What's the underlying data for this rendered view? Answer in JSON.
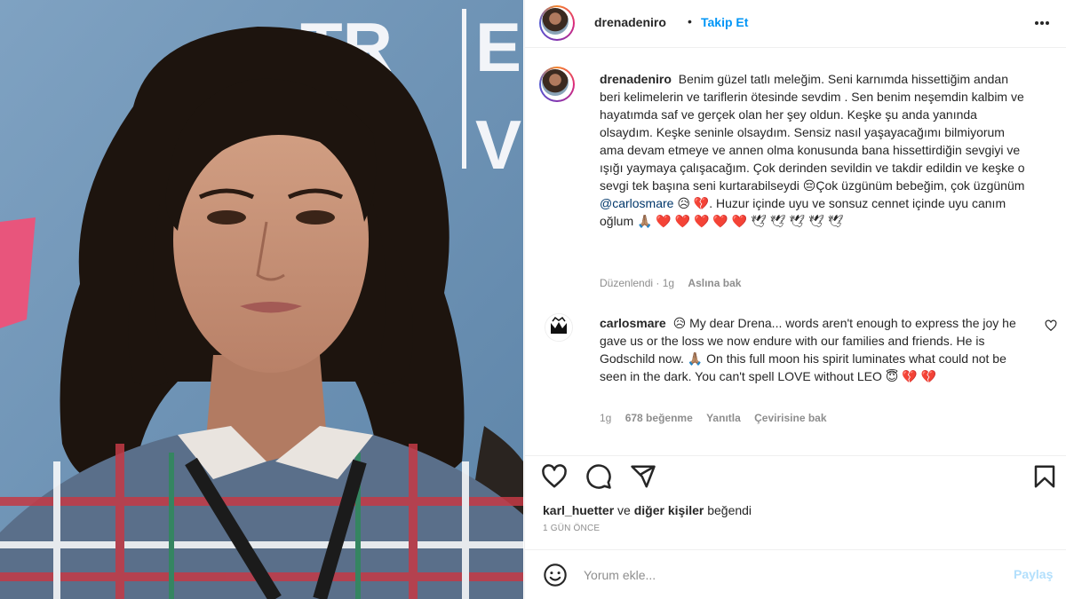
{
  "photo": {
    "background_letters": [
      "TR",
      "T",
      "E",
      "V"
    ],
    "colors": {
      "backdrop": "#6e93b4",
      "hair": "#1d140e",
      "skin": "#c9957a",
      "pink": "#e8557c"
    }
  },
  "post": {
    "author": "drenadeniro",
    "follow_label": "Takip Et",
    "separator": "•",
    "caption": {
      "username": "drenadeniro",
      "text_before_mention": "Benim güzel tatlı meleğim. Seni karnımda hissettiğim andan beri kelimelerin ve tariflerin ötesinde sevdim . Sen benim neşemdin kalbim ve hayatımda saf ve gerçek olan her şey oldun. Keşke şu anda yanında olsaydım. Keşke seninle olsaydım. Sensiz nasıl yaşayacağımı bilmiyorum ama devam etmeye ve annen olma konusunda bana hissettirdiğin sevgiyi ve ışığı yaymaya çalışacağım. Çok derinden sevildin ve takdir edildin ve keşke o sevgi tek başına seni kurtarabilseydi 😔Çok üzgünüm bebeğim, çok üzgünüm",
      "mention": "@carlosmare",
      "text_after_mention": " 😥 💔. Huzur içinde uyu ve sonsuz cennet içinde uyu canım oğlum 🙏🏽 ❤️ ❤️ ❤️ ❤️ ❤️ 🕊 🕊 🕊 🕊 🕊",
      "meta_edited": "Düzenlendi · 1g",
      "meta_see_original": "Aslına bak"
    },
    "comment": {
      "username": "carlosmare",
      "text": "😥 My dear Drena... words aren't enough to express the joy he gave us or the loss we now endure with our families and friends. He is Godschild now. 🙏🏽 On this full moon his spirit luminates what could not be seen in the dark. You can't spell LOVE without LEO 😇 💔 💔",
      "time": "1g",
      "likes": "678 beğenme",
      "reply": "Yanıtla",
      "see_translation": "Çevirisine bak"
    },
    "actions": {
      "like": "heart-icon",
      "comment": "comment-icon",
      "share": "share-icon",
      "save": "bookmark-icon"
    },
    "liked_by": {
      "user": "karl_huetter",
      "conj": "ve",
      "others": "diğer kişiler",
      "suffix": "beğendi"
    },
    "timestamp": "1 GÜN ÖNCE",
    "comment_box": {
      "placeholder": "Yorum ekle...",
      "post_label": "Paylaş"
    }
  }
}
